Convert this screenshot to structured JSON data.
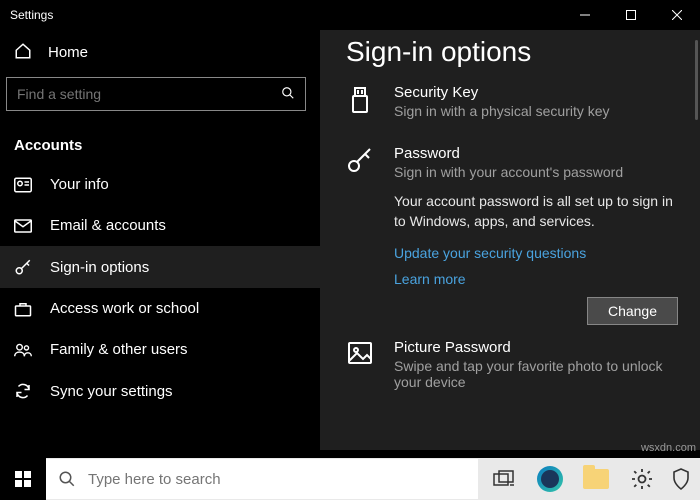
{
  "window": {
    "title": "Settings"
  },
  "sidebar": {
    "home": "Home",
    "searchPlaceholder": "Find a setting",
    "category": "Accounts",
    "items": [
      {
        "label": "Your info"
      },
      {
        "label": "Email & accounts"
      },
      {
        "label": "Sign-in options"
      },
      {
        "label": "Access work or school"
      },
      {
        "label": "Family & other users"
      },
      {
        "label": "Sync your settings"
      }
    ]
  },
  "main": {
    "title": "Sign-in options",
    "securityKey": {
      "title": "Security Key",
      "sub": "Sign in with a physical security key"
    },
    "password": {
      "title": "Password",
      "sub": "Sign in with your account's password",
      "desc": "Your account password is all set up to sign in to Windows, apps, and services.",
      "link1": "Update your security questions",
      "link2": "Learn more",
      "changeBtn": "Change"
    },
    "picture": {
      "title": "Picture Password",
      "sub": "Swipe and tap your favorite photo to unlock your device"
    }
  },
  "taskbar": {
    "searchPlaceholder": "Type here to search"
  },
  "watermark": "wsxdn.com"
}
